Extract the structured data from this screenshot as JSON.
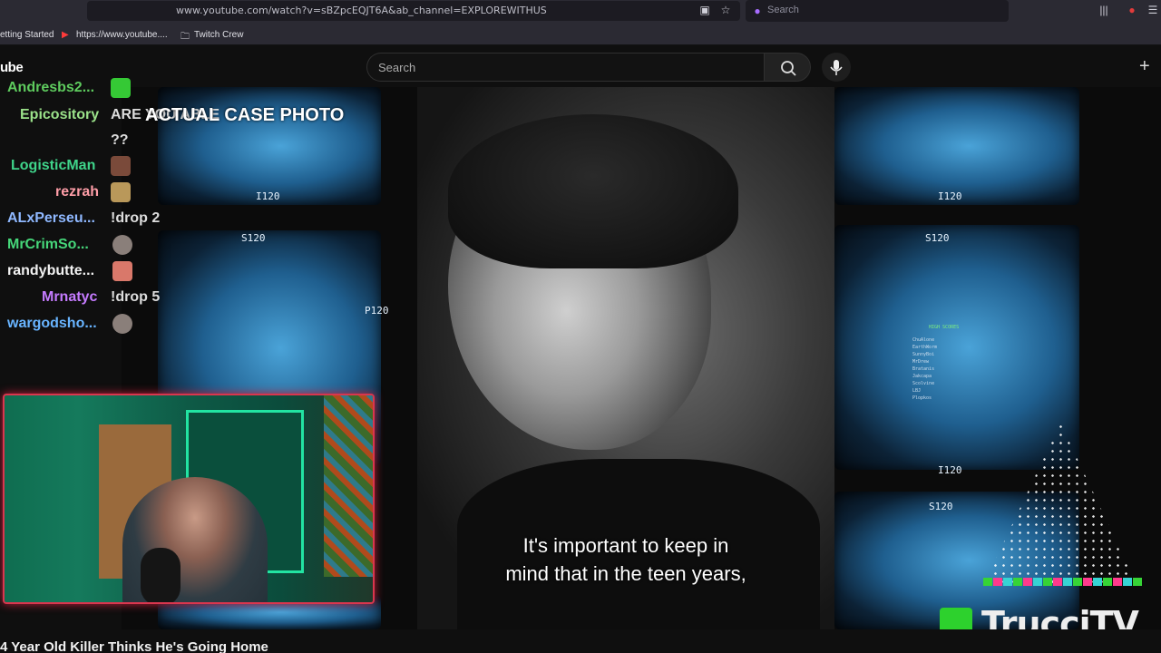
{
  "browser": {
    "url": "www.youtube.com/watch?v=sBZpcEQJT6A&ab_channel=EXPLOREWITHUS",
    "search_placeholder": "Search",
    "bookmarks": [
      "etting Started",
      "https://www.youtube....",
      "Twitch Crew"
    ]
  },
  "youtube": {
    "logo_text": "ube",
    "search_placeholder": "Search",
    "video_title": "4 Year Old Killer Thinks He's Going Home"
  },
  "video": {
    "top_caption": "ACTUAL CASE PHOTO",
    "subtitle_line1": "It's important to keep in",
    "subtitle_line2": "mind that in the teen years,",
    "mri_labels": [
      "I120",
      "S120",
      "P120",
      "I120",
      "S120",
      "I120",
      "S120"
    ],
    "brand_text": "TrucciTV",
    "overlay_rows": [
      "HIGH SCORES",
      "ChuAlone",
      "EarthWorm",
      "SunnyBoi",
      "MrDrew",
      "Bratanis",
      "Jakcapa",
      "Scolvine",
      "LBJ",
      "Plopkos"
    ]
  },
  "chat": [
    {
      "name": "Andresbs2...",
      "color": "#5ecb5e",
      "message": ""
    },
    {
      "name": "Epicository",
      "color": "#9be28a",
      "message": "ARE YOU ABLE"
    },
    {
      "name": "",
      "color": "#ffffff",
      "message": "??"
    },
    {
      "name": "LogisticMan",
      "color": "#3fd48a",
      "message": ""
    },
    {
      "name": "rezrah",
      "color": "#ff9ea8",
      "message": ""
    },
    {
      "name": "ALxPerseu...",
      "color": "#8fb8ff",
      "message": "!drop 2"
    },
    {
      "name": "MrCrimSo...",
      "color": "#46d77a",
      "message": ""
    },
    {
      "name": "randybutte...",
      "color": "#f2f2f2",
      "message": ""
    },
    {
      "name": "Mrnatyc",
      "color": "#c57bff",
      "message": "!drop 5"
    },
    {
      "name": "wargodsho...",
      "color": "#68b4ff",
      "message": ""
    }
  ],
  "colors": {
    "accent_red": "#d9364e",
    "brand_green": "#2dd12d",
    "mri_blue": "#4aa3d8"
  }
}
